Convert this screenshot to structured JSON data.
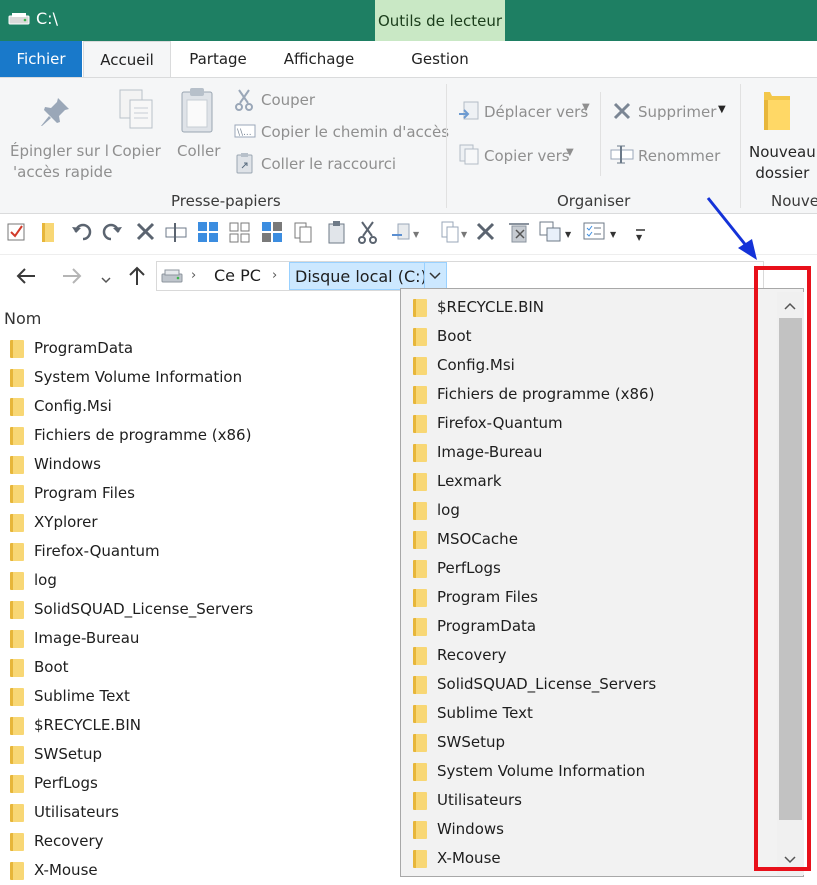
{
  "window": {
    "title": "C:\\"
  },
  "tabs": {
    "file": "Fichier",
    "home": "Accueil",
    "share": "Partage",
    "view": "Affichage",
    "context_label": "Outils de lecteur",
    "context_tab": "Gestion"
  },
  "ribbon": {
    "clipboard": {
      "pin_line1": "Épingler sur l",
      "pin_line2": "'accès rapide",
      "copy": "Copier",
      "paste": "Coller",
      "cut": "Couper",
      "copy_path": "Copier le chemin d'accès",
      "paste_shortcut": "Coller le raccourci",
      "group_label": "Presse-papiers"
    },
    "organize": {
      "move_to": "Déplacer vers",
      "copy_to": "Copier vers",
      "delete": "Supprimer",
      "rename": "Renommer",
      "group_label": "Organiser"
    },
    "new": {
      "folder_line1": "Nouveau",
      "folder_line2": "dossier",
      "group_label": "Nouve"
    }
  },
  "address": {
    "crumb1": "Ce PC",
    "crumb2": "Disque local (C:)"
  },
  "list": {
    "header": "Nom",
    "items": [
      "ProgramData",
      "System Volume Information",
      "Config.Msi",
      "Fichiers de programme (x86)",
      "Windows",
      "Program Files",
      "XYplorer",
      "Firefox-Quantum",
      "log",
      "SolidSQUAD_License_Servers",
      "Image-Bureau",
      "Boot",
      "Sublime Text",
      "$RECYCLE.BIN",
      "SWSetup",
      "PerfLogs",
      "Utilisateurs",
      "Recovery",
      "X-Mouse"
    ]
  },
  "dropdown": {
    "items": [
      "$RECYCLE.BIN",
      "Boot",
      "Config.Msi",
      "Fichiers de programme (x86)",
      "Firefox-Quantum",
      "Image-Bureau",
      "Lexmark",
      "log",
      "MSOCache",
      "PerfLogs",
      "Program Files",
      "ProgramData",
      "Recovery",
      "SolidSQUAD_License_Servers",
      "Sublime Text",
      "SWSetup",
      "System Volume Information",
      "Utilisateurs",
      "Windows",
      "X-Mouse"
    ]
  },
  "colors": {
    "titlebar": "#1e7f63",
    "file_tab": "#1979ca",
    "context_tab": "#c9e8c5",
    "highlight": "#cce8ff",
    "annotation": "#e8101a",
    "arrow": "#1432d8"
  }
}
